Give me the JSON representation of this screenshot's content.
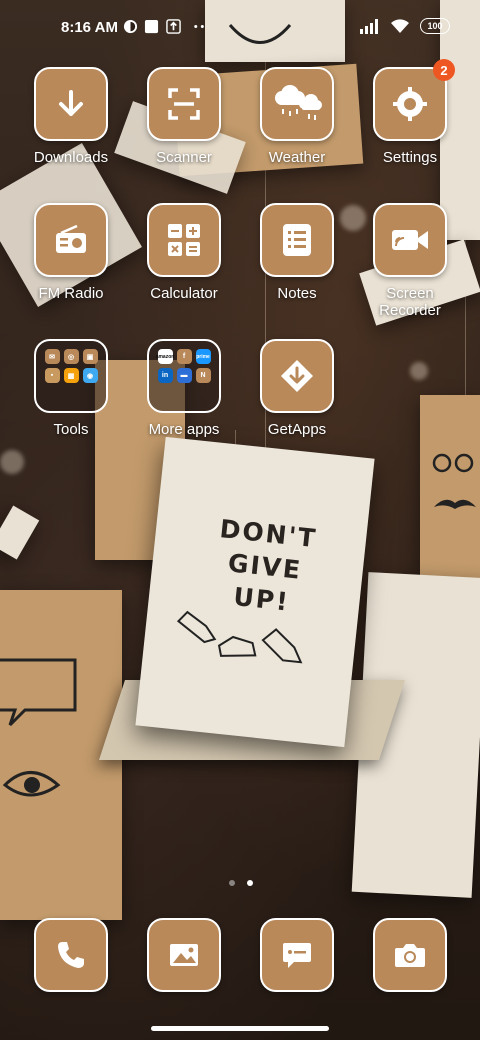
{
  "status_bar": {
    "time": "8:16 AM",
    "battery": "100",
    "icons": [
      "vpn-icon",
      "square-notification-icon",
      "upload-icon",
      "more-dots-icon",
      "signal-icon",
      "wifi-icon",
      "battery-icon"
    ]
  },
  "apps": [
    {
      "label": "Downloads",
      "icon": "download-arrow-icon"
    },
    {
      "label": "Scanner",
      "icon": "scan-frame-icon"
    },
    {
      "label": "Weather",
      "icon": "cloud-rain-icon"
    },
    {
      "label": "Settings",
      "icon": "gear-icon",
      "badge": "2"
    },
    {
      "label": "FM Radio",
      "icon": "radio-icon"
    },
    {
      "label": "Calculator",
      "icon": "calculator-icon"
    },
    {
      "label": "Notes",
      "icon": "notes-list-icon"
    },
    {
      "label": "Screen\nRecorder",
      "icon": "video-camera-icon"
    },
    {
      "label": "GetApps",
      "icon": "diamond-download-icon"
    }
  ],
  "folders": [
    {
      "label": "Tools",
      "apps": [
        "mail",
        "whatsapp",
        "files",
        "explorer",
        "grid",
        "browser"
      ]
    },
    {
      "label": "More apps",
      "apps": [
        "amazon",
        "facebook",
        "prime-video",
        "linkedin",
        "netflix-like",
        "notes-n"
      ]
    }
  ],
  "folder_mini_labels": {
    "more_apps_amazon": "amazon",
    "more_apps_fb": "f",
    "more_apps_prime": "prime",
    "more_apps_in": "in",
    "more_apps_n": "N"
  },
  "page_indicator": {
    "pages": 2,
    "active": 2
  },
  "dock": [
    {
      "name": "phone",
      "icon": "phone-icon"
    },
    {
      "name": "gallery",
      "icon": "image-icon"
    },
    {
      "name": "messages",
      "icon": "message-icon"
    },
    {
      "name": "camera",
      "icon": "camera-icon"
    }
  ],
  "wallpaper": {
    "card_text_line1": "DON'T",
    "card_text_line2": "GIVE",
    "card_text_line3": "UP!"
  },
  "colors": {
    "icon_bg": "#b9895a",
    "icon_border": "#ffffff",
    "badge": "#ee5622"
  }
}
